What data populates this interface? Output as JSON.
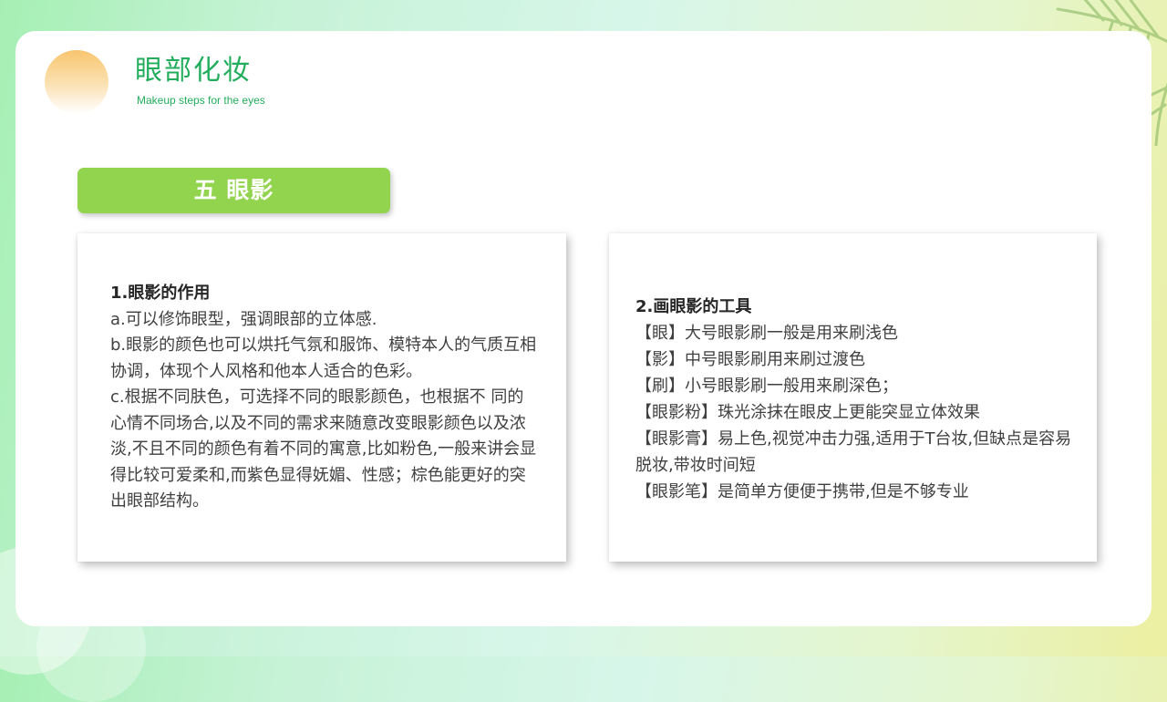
{
  "header": {
    "title": "眼部化妆",
    "subtitle": "Makeup steps for the eyes"
  },
  "section": {
    "label": "五 眼影"
  },
  "left_panel": {
    "heading": "1.眼影的作用",
    "lines": [
      "a.可以修饰眼型，强调眼部的立体感.",
      "b.眼影的颜色也可以烘托气氛和服饰、模特本人的气质互相协调，体现个人风格和他本人适合的色彩。",
      "c.根据不同肤色，可选择不同的眼影颜色，也根据不 同的心情不同场合,以及不同的需求来随意改变眼影颜色以及浓淡,不且不同的颜色有着不同的寓意,比如粉色,一般来讲会显得比较可爱柔和,而紫色显得妩媚、性感；棕色能更好的突出眼部结构。"
    ]
  },
  "right_panel": {
    "heading": "2.画眼影的工具",
    "lines": [
      "【眼】大号眼影刷一般是用来刷浅色",
      "【影】中号眼影刷用来刷过渡色",
      "【刷】小号眼影刷一般用来刷深色；",
      "【眼影粉】珠光涂抹在眼皮上更能突显立体效果",
      "【眼影膏】易上色,视觉冲击力强,适用于T台妆,但缺点是容易脱妆,带妆时间短",
      "【眼影笔】是简单方便便于携带,但是不够专业"
    ]
  },
  "colors": {
    "accent_green": "#22ad5c",
    "pill_green": "#92d44e",
    "sun_orange": "#f8c56e",
    "text_dark": "#404040"
  }
}
